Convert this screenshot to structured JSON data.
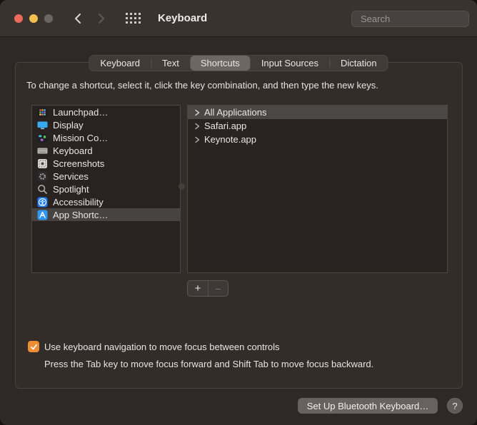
{
  "window": {
    "title": "Keyboard"
  },
  "titlebar": {
    "search_placeholder": "Search"
  },
  "tabs": {
    "items": [
      {
        "label": "Keyboard"
      },
      {
        "label": "Text"
      },
      {
        "label": "Shortcuts"
      },
      {
        "label": "Input Sources"
      },
      {
        "label": "Dictation"
      }
    ],
    "selected": "Shortcuts"
  },
  "content": {
    "instruction": "To change a shortcut, select it, click the key combination, and then type the new keys.",
    "categories": [
      {
        "label": "Launchpad…",
        "icon": "launchpad-icon"
      },
      {
        "label": "Display",
        "icon": "display-icon"
      },
      {
        "label": "Mission Co…",
        "icon": "mission-control-icon"
      },
      {
        "label": "Keyboard",
        "icon": "keyboard-icon"
      },
      {
        "label": "Screenshots",
        "icon": "screenshots-icon"
      },
      {
        "label": "Services",
        "icon": "services-icon"
      },
      {
        "label": "Spotlight",
        "icon": "spotlight-icon"
      },
      {
        "label": "Accessibility",
        "icon": "accessibility-icon"
      },
      {
        "label": "App Shortc…",
        "icon": "app-shortcuts-icon",
        "selected": true
      }
    ],
    "shortcut_rows": [
      {
        "label": "All Applications",
        "selected": true
      },
      {
        "label": "Safari.app"
      },
      {
        "label": "Keynote.app"
      }
    ],
    "add_label": "+",
    "remove_label": "−",
    "checkbox_label": "Use keyboard navigation to move focus between controls",
    "checkbox_checked": true,
    "checkbox_hint": "Press the Tab key to move focus forward and Shift Tab to move focus backward."
  },
  "footer": {
    "setup_button": "Set Up Bluetooth Keyboard…",
    "help_button": "?"
  },
  "colors": {
    "accent_orange": "#ec8e33",
    "traffic_red": "#ec6a5e",
    "traffic_yellow": "#f5bf4f",
    "selection_gray": "#4a4745",
    "window_bg": "#2e2826",
    "panel_bg": "#332d2a",
    "list_bg": "#282321"
  }
}
